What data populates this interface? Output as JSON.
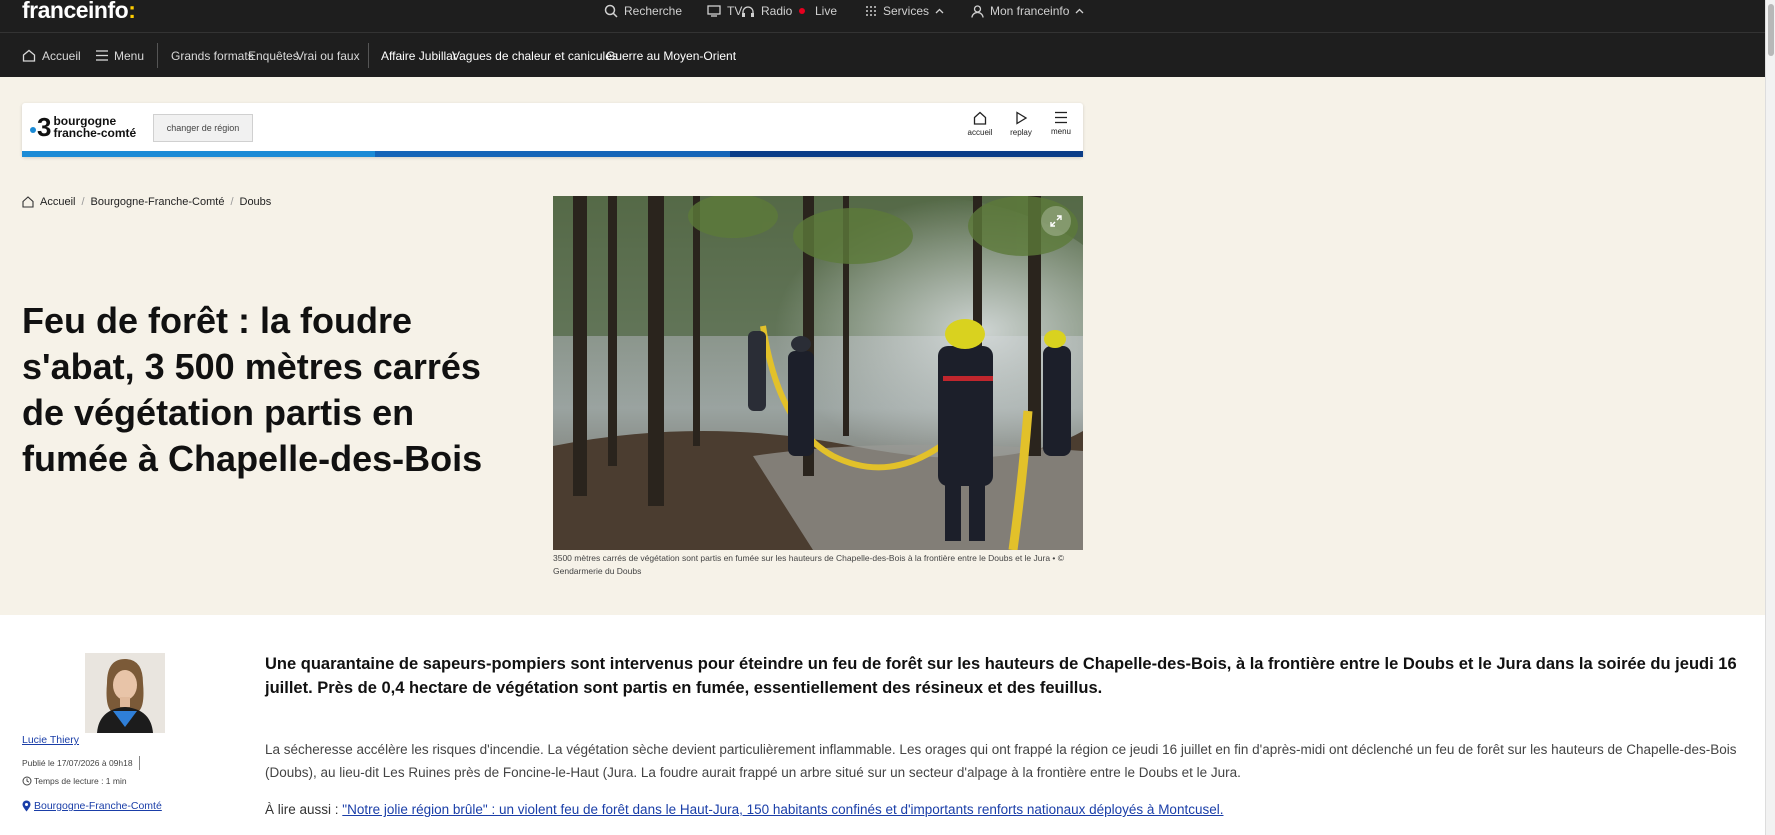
{
  "topbar": {
    "logo": "franceinfo",
    "logo_colon": ":",
    "search": "Recherche",
    "tv": "TV",
    "radio": "Radio",
    "live": "Live",
    "services": "Services",
    "account": "Mon franceinfo"
  },
  "navbar": {
    "home": "Accueil",
    "menu": "Menu",
    "sections": [
      "Grands formats",
      "Enquêtes",
      "Vrai ou faux"
    ],
    "hot_topics": [
      "Affaire Jubillar",
      "Vagues de chaleur et canicules",
      "Guerre au Moyen-Orient"
    ]
  },
  "region": {
    "channel_number": "3",
    "name_line1": "bourgogne",
    "name_line2": "franche-comté",
    "change_label": "changer de région",
    "actions": [
      "accueil",
      "replay",
      "menu"
    ],
    "colors": {
      "light_blue": "#1b8bd6",
      "blue": "#1565b8",
      "dark_blue": "#0b3d88"
    }
  },
  "breadcrumb": [
    "Accueil",
    "Bourgogne-Franche-Comté",
    "Doubs"
  ],
  "article": {
    "headline": "Feu de forêt : la foudre s'abat, 3 500 mètres carrés de végétation partis en fumée à Chapelle-des-Bois",
    "caption": "3500 mètres carrés de végétation sont partis en fumée sur les hauteurs de Chapelle-des-Bois à la frontière entre le Doubs et le Jura • © Gendarmerie du Doubs",
    "author": "Lucie Thiery",
    "published": "Publié le 17/07/2026 à 09h18",
    "reading_time": "Temps de lecture : 1 min",
    "region_tag": "Bourgogne-Franche-Comté",
    "lead": "Une quarantaine de sapeurs-pompiers sont intervenus pour éteindre un feu de forêt sur les hauteurs de Chapelle-des-Bois, à la frontière entre le Doubs et le Jura dans la soirée du jeudi 16 juillet. Près de 0,4 hectare de végétation sont partis en fumée, essentiellement des résineux et des feuillus.",
    "body": "La sécheresse accélère les risques d'incendie. La végétation sèche devient particulièrement inflammable. Les orages qui ont frappé la région ce jeudi 16 juillet en fin d'après-midi ont déclenché un feu de forêt sur les hauteurs de Chapelle-des-Bois (Doubs), au lieu-dit Les Ruines près de Foncine-le-Haut (Jura. La foudre aurait frappé un arbre situé sur un secteur d'alpage à la frontière entre le Doubs et le Jura.",
    "read_also_label": "À lire aussi :",
    "read_also_link": "\"Notre jolie région brûle\" : un violent feu de forêt dans le Haut-Jura, 150 habitants confinés et d'importants renforts nationaux déployés à Montcusel."
  }
}
